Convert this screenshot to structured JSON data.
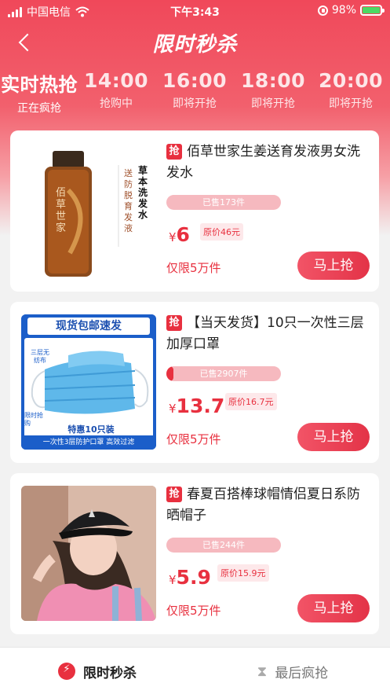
{
  "status": {
    "carrier": "中国电信",
    "time": "下午3:43",
    "battery": "98%"
  },
  "nav": {
    "title": "限时秒杀",
    "back_icon": "chevron-left-icon"
  },
  "timeline": [
    {
      "time": "实时热抢",
      "state": "正在疯抢"
    },
    {
      "time": "14:00",
      "state": "抢购中"
    },
    {
      "time": "16:00",
      "state": "即将开抢"
    },
    {
      "time": "18:00",
      "state": "即将开抢"
    },
    {
      "time": "20:00",
      "state": "即将开抢"
    }
  ],
  "badge": "抢",
  "products": [
    {
      "title": "佰草世家生姜送育发液男女洗发水",
      "sold": "已售173件",
      "sold_fraction": 0.0,
      "yen": "¥",
      "price": "6",
      "original": "原价46元",
      "limit": "仅限5万件",
      "buy": "马上抢",
      "image": {
        "brand": "佰草世家",
        "side_title": "草本洗发水",
        "side_text": "送防脱育发液"
      }
    },
    {
      "title": "【当天发货】10只一次性三层加厚口罩",
      "sold": "已售2907件",
      "sold_fraction": 0.06,
      "yen": "¥",
      "price": "13.7",
      "original": "原价16.7元",
      "limit": "仅限5万件",
      "buy": "马上抢",
      "image": {
        "banner": "现货包邮速发",
        "tag": "三层无纺布",
        "corner": "限时抢购",
        "deal": "特惠10只装",
        "footer": "一次性3层防护口罩  高效过滤"
      }
    },
    {
      "title": "春夏百搭棒球帽情侣夏日系防晒帽子",
      "sold": "已售244件",
      "sold_fraction": 0.0,
      "yen": "¥",
      "price": "5.9",
      "original": "原价15.9元",
      "limit": "仅限5万件",
      "buy": "马上抢"
    }
  ],
  "tabs": [
    {
      "label": "限时秒杀",
      "icon": "lightning-icon"
    },
    {
      "label": "最后疯抢",
      "icon": "hourglass-icon"
    }
  ],
  "colors": {
    "accent": "#e8303f",
    "hero": "#f0485a"
  }
}
